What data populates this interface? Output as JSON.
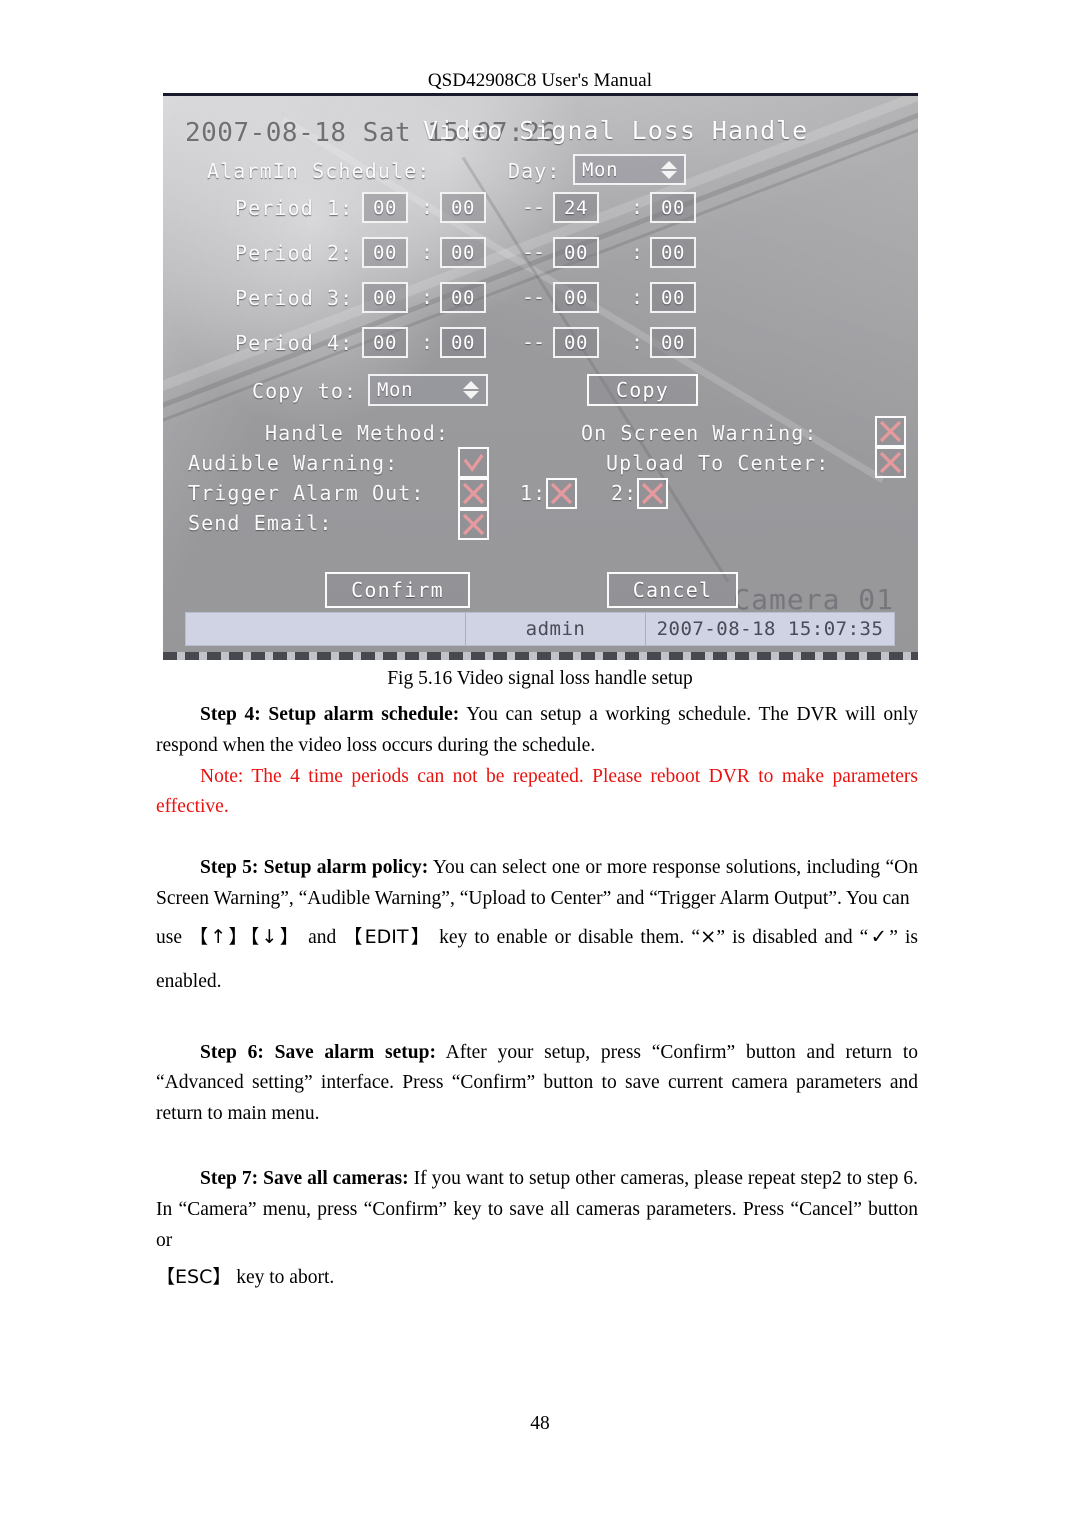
{
  "header": {
    "title": "QSD42908C8 User's Manual"
  },
  "figure": {
    "osd_datetime": "2007-08-18 Sat 15:07:26",
    "osd_camera": "Camera 01",
    "menu_title": "Video Signal Loss Handle",
    "schedule_label": "AlarmIn Schedule:",
    "day_label": "Day:",
    "day_value": "Mon",
    "periods": [
      {
        "label": "Period 1:",
        "start_hour": "00",
        "start_min": "00",
        "end_hour": "24",
        "end_min": "00"
      },
      {
        "label": "Period 2:",
        "start_hour": "00",
        "start_min": "00",
        "end_hour": "00",
        "end_min": "00"
      },
      {
        "label": "Period 3:",
        "start_hour": "00",
        "start_min": "00",
        "end_hour": "00",
        "end_min": "00"
      },
      {
        "label": "Period 4:",
        "start_hour": "00",
        "start_min": "00",
        "end_hour": "00",
        "end_min": "00"
      }
    ],
    "time_separator": ":",
    "range_separator": "--",
    "copy_to_label": "Copy to:",
    "copy_to_value": "Mon",
    "copy_button": "Copy",
    "handle_method_label": "Handle Method:",
    "audible_warning_label": "Audible Warning:",
    "trigger_alarm_out_label": "Trigger Alarm Out:",
    "send_email_label": "Send Email:",
    "on_screen_warning_label": "On Screen Warning:",
    "upload_to_center_label": "Upload To Center:",
    "alarm_out_1_label": "1:",
    "alarm_out_2_label": "2:",
    "states": {
      "on_screen_warning": "x",
      "upload_to_center": "x",
      "audible_warning": "check",
      "trigger_alarm_out": "x",
      "alarm_out_1": "x",
      "alarm_out_2": "x",
      "send_email": "x"
    },
    "confirm_button": "Confirm",
    "cancel_button": "Cancel",
    "statusbar": {
      "blank": "",
      "user": "admin",
      "datetime": "2007-08-18 15:07:35"
    },
    "mark_color": "#e79a9e"
  },
  "caption": "Fig 5.16 Video signal loss handle setup",
  "body": {
    "step4_bold": "Step 4: Setup alarm schedule:",
    "step4_text": " You can setup a working schedule. The DVR will only respond when the video loss occurs during the schedule.",
    "note_text": "Note: The 4 time periods can not be repeated. Please reboot DVR to make parameters effective.",
    "step5_bold": "Step 5: Setup alarm policy:",
    "step5_text": " You can select one or more response solutions, including “On Screen Warning”, “Audible Warning”, “Upload to Center” and “Trigger Alarm Output”. You can",
    "step5_line3_a": "use ",
    "step5_key_up": "【↑】",
    "step5_key_down": "【↓】",
    "step5_line3_b": " and ",
    "step5_key_edit": "【EDIT】",
    "step5_line3_c": " key to enable or disable them. “",
    "step5_sym_x": "×",
    "step5_line3_d": "” is disabled and “",
    "step5_sym_check": "✓",
    "step5_line3_e": "” is enabled.",
    "step6_bold": "Step 6: Save alarm setup:",
    "step6_text": " After your setup, press “Confirm” button and return to “Advanced setting” interface. Press “Confirm” button to save current camera parameters and return to main menu.",
    "step7_bold": "Step 7: Save all cameras:",
    "step7_text": " If you want to setup other cameras, please repeat step2 to step 6. In “Camera” menu, press “Confirm” key to save all cameras parameters. Press “Cancel” button or",
    "step7_key_esc": "【ESC】",
    "step7_line3": " key to abort."
  },
  "page_number": "48"
}
